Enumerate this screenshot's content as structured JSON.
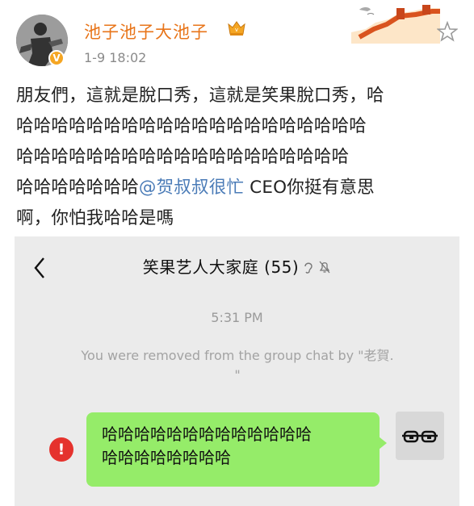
{
  "post": {
    "username": "池子池子大池子",
    "timestamp": "1-9 18:02",
    "verified_badge": "V",
    "text_lines": [
      "朋友們，這就是脫口秀，這就是笑果脫口秀，哈",
      "哈哈哈哈哈哈哈哈哈哈哈哈哈哈哈哈哈哈哈哈",
      "哈哈哈哈哈哈哈哈哈哈哈哈哈哈哈哈哈哈哈",
      "哈哈哈哈哈哈哈",
      "啊，你怕我哈哈是嗎"
    ],
    "mention": "@贺叔叔很忙",
    "after_mention": " CEO你挺有意思",
    "icons": [
      "verified-icon",
      "vip-crown-icon",
      "great-wall-icon",
      "follow-star-icon"
    ]
  },
  "chat": {
    "title": "笑果艺人大家庭 (55)",
    "time": "5:31 PM",
    "system_notice": "You were removed from the group chat by \"老賀.\n\"",
    "bubble_lines": [
      "哈哈哈哈哈哈哈哈哈哈哈哈哈",
      "哈哈哈哈哈哈哈哈"
    ],
    "error_symbol": "!",
    "colors": {
      "bubble": "#95ec69",
      "error": "#e5322d",
      "username": "#e8751a",
      "mention": "#4a7bb7"
    }
  }
}
